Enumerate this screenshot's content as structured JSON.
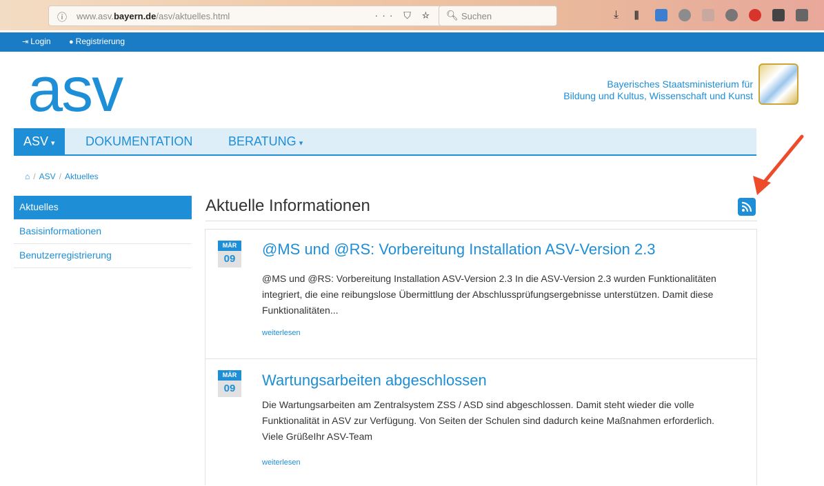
{
  "browser": {
    "url_prefix": "www.asv.",
    "url_domain": "bayern.de",
    "url_path": "/asv/aktuelles.html",
    "url_actions": "··· ⛉ ☆",
    "search_placeholder": "Suchen"
  },
  "topbar": {
    "login_label": "Login",
    "register_label": "Registrierung"
  },
  "header": {
    "logo_text": "asv",
    "ministry_line1": "Bayerisches Staatsministerium für",
    "ministry_line2": "Bildung und Kultus, Wissenschaft und Kunst"
  },
  "nav": {
    "items": [
      {
        "label": "ASV"
      },
      {
        "label": "DOKUMENTATION"
      },
      {
        "label": "BERATUNG"
      }
    ]
  },
  "breadcrumb": {
    "items": [
      "ASV",
      "Aktuelles"
    ]
  },
  "sidebar": {
    "items": [
      {
        "label": "Aktuelles"
      },
      {
        "label": "Basisinformationen"
      },
      {
        "label": "Benutzerregistrierung"
      }
    ]
  },
  "main": {
    "title": "Aktuelle Informationen",
    "news": [
      {
        "month": "MÄR",
        "day": "09",
        "title": "@MS und @RS: Vorbereitung Installation ASV-Version 2.3",
        "text": "@MS und @RS: Vorbereitung Installation ASV-Version 2.3 In die ASV-Version 2.3 wurden Funktionalitäten integriert, die eine reibungslose Übermittlung der Abschlussprüfungsergebnisse unterstützen. Damit diese Funktionalitäten...",
        "more": "weiterlesen"
      },
      {
        "month": "MÄR",
        "day": "09",
        "title": "Wartungsarbeiten abgeschlossen",
        "text": "Die Wartungsarbeiten am Zentralsystem ZSS / ASD sind abgeschlossen. Damit steht wieder die volle Funktionalität in ASV zur Verfügung. Von Seiten der Schulen sind dadurch keine Maßnahmen erforderlich. Viele GrüßeIhr ASV-Team",
        "more": "weiterlesen"
      }
    ]
  },
  "colors": {
    "primary": "#1e8ed6",
    "top_strip": "#1a7cc4",
    "nav_bg": "#deeef9",
    "annotation_arrow": "#ee4b2b"
  }
}
